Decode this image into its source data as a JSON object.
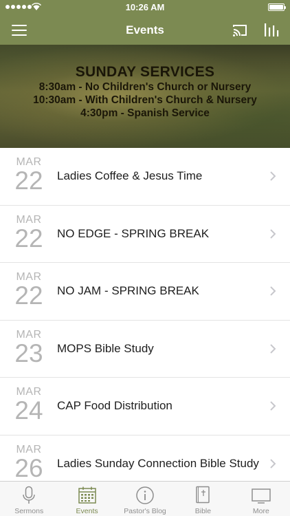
{
  "status_bar": {
    "time": "10:26 AM"
  },
  "nav": {
    "title": "Events"
  },
  "banner": {
    "title": "SUNDAY SERVICES",
    "lines": [
      "8:30am - No Children's Church or Nursery",
      "10:30am - With Children's Church & Nursery",
      "4:30pm - Spanish Service"
    ]
  },
  "events": [
    {
      "month": "MAR",
      "day": "22",
      "title": "Ladies Coffee & Jesus Time"
    },
    {
      "month": "MAR",
      "day": "22",
      "title": "NO EDGE - SPRING BREAK"
    },
    {
      "month": "MAR",
      "day": "22",
      "title": "NO JAM - SPRING BREAK"
    },
    {
      "month": "MAR",
      "day": "23",
      "title": "MOPS Bible Study"
    },
    {
      "month": "MAR",
      "day": "24",
      "title": "CAP Food Distribution"
    },
    {
      "month": "MAR",
      "day": "26",
      "title": "Ladies Sunday Connection Bible Study"
    }
  ],
  "tabs": [
    {
      "label": "Sermons",
      "icon": "microphone-icon",
      "active": false
    },
    {
      "label": "Events",
      "icon": "calendar-icon",
      "active": true
    },
    {
      "label": "Pastor's Blog",
      "icon": "info-icon",
      "active": false
    },
    {
      "label": "Bible",
      "icon": "bible-icon",
      "active": false
    },
    {
      "label": "More",
      "icon": "tv-icon",
      "active": false
    }
  ],
  "colors": {
    "accent": "#7c8a52",
    "date_gray": "#b5b5b5",
    "tab_gray": "#8e8e8e"
  }
}
